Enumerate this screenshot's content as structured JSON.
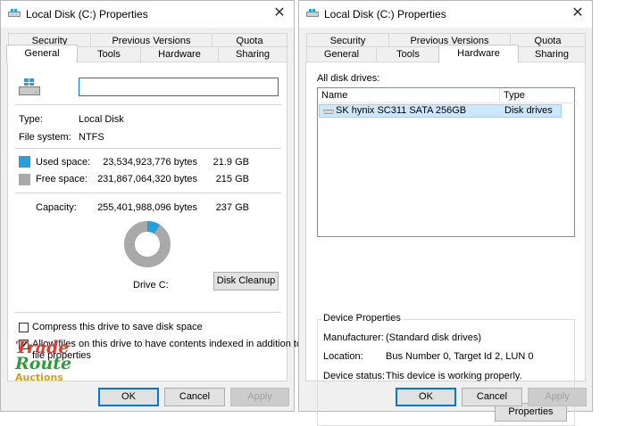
{
  "window_title": "Local Disk (C:) Properties",
  "tabs_row1": [
    "Security",
    "Previous Versions",
    "Quota"
  ],
  "tabs_row2": [
    "General",
    "Tools",
    "Hardware",
    "Sharing"
  ],
  "general": {
    "name_value": "",
    "type_label": "Type:",
    "type_value": "Local Disk",
    "fs_label": "File system:",
    "fs_value": "NTFS",
    "used_label": "Used space:",
    "used_bytes": "23,534,923,776 bytes",
    "used_gb": "21.9 GB",
    "used_fraction": 0.092,
    "free_label": "Free space:",
    "free_bytes": "231,867,064,320 bytes",
    "free_gb": "215 GB",
    "capacity_label": "Capacity:",
    "capacity_bytes": "255,401,988,096 bytes",
    "capacity_gb": "237 GB",
    "drive_label": "Drive C:",
    "cleanup_button": "Disk Cleanup",
    "compress_label": "Compress this drive to save disk space",
    "compress_checked": false,
    "index_label_line1": "Allow files on this drive to have contents indexed in addition to",
    "index_label_line2": "file properties",
    "index_checked": true,
    "used_color": "#26a0da",
    "free_color": "#a9a9a9"
  },
  "hardware": {
    "all_drives_label": "All disk drives:",
    "col_name": "Name",
    "col_type": "Type",
    "rows": [
      {
        "name": "SK hynix SC311 SATA 256GB",
        "type": "Disk drives"
      }
    ],
    "group_title": "Device Properties",
    "manufacturer_label": "Manufacturer:",
    "manufacturer_value": "(Standard disk drives)",
    "location_label": "Location:",
    "location_value": "Bus Number 0, Target Id 2, LUN 0",
    "status_label": "Device status:",
    "status_value": "This device is working properly.",
    "properties_button": "Properties"
  },
  "footer": {
    "ok": "OK",
    "cancel": "Cancel",
    "apply": "Apply"
  },
  "watermark": {
    "line1": "Trade",
    "line2": "Route",
    "line3": "Auctions"
  }
}
